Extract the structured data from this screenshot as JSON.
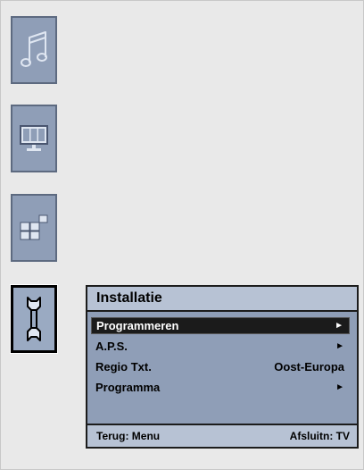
{
  "sidebar": {
    "items": [
      {
        "icon": "music-note-icon"
      },
      {
        "icon": "tv-picture-icon"
      },
      {
        "icon": "features-blocks-icon"
      },
      {
        "icon": "wrench-icon",
        "active": true
      }
    ]
  },
  "panel": {
    "title": "Installatie",
    "rows": [
      {
        "label": "Programmeren",
        "value": "►",
        "selected": true
      },
      {
        "label": "A.P.S.",
        "value": "►"
      },
      {
        "label": "Regio Txt.",
        "value": "Oost-Europa"
      },
      {
        "label": "Programma",
        "value": "►"
      }
    ],
    "footer": {
      "back": "Terug: Menu",
      "exit": "Afsluitn: TV"
    }
  },
  "colors": {
    "tile": "#8f9eb7",
    "tile_border": "#5d6a80",
    "panel_header": "#b7c2d4",
    "selected_row": "#1b1b1b"
  }
}
